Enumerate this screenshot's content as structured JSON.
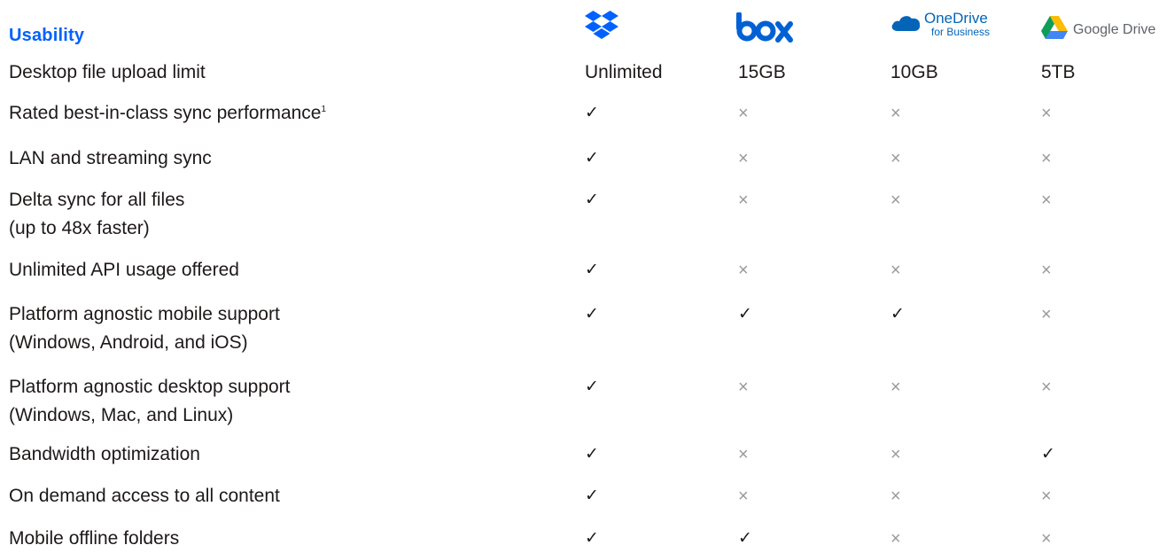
{
  "section_title": "Usability",
  "providers": [
    {
      "name": "Dropbox",
      "icon": "dropbox-logo-icon",
      "color": "#0061fe"
    },
    {
      "name": "box",
      "icon": "box-logo-icon",
      "color": "#0061d5"
    },
    {
      "name": "OneDrive",
      "subtitle": "for Business",
      "icon": "onedrive-cloud-icon",
      "color": "#0364b8"
    },
    {
      "name": "Google Drive",
      "icon": "google-drive-triangle-icon",
      "color": "#5f6368"
    }
  ],
  "rows": [
    {
      "label": [
        "Desktop file upload limit"
      ],
      "values": [
        "Unlimited",
        "15GB",
        "10GB",
        "5TB"
      ]
    },
    {
      "label": [
        "Rated best-in-class sync performance"
      ],
      "footnote": "1",
      "values": [
        "check",
        "cross",
        "cross",
        "cross"
      ]
    },
    {
      "label": [
        "LAN and streaming sync"
      ],
      "values": [
        "check",
        "cross",
        "cross",
        "cross"
      ]
    },
    {
      "label": [
        "Delta sync for all files",
        "(up to 48x faster)"
      ],
      "values": [
        "check",
        "cross",
        "cross",
        "cross"
      ]
    },
    {
      "label": [
        "Unlimited API usage offered"
      ],
      "values": [
        "check",
        "cross",
        "cross",
        "cross"
      ]
    },
    {
      "label": [
        "Platform agnostic mobile support",
        "(Windows, Android, and iOS)"
      ],
      "values": [
        "check",
        "check",
        "check",
        "cross"
      ]
    },
    {
      "label": [
        "Platform agnostic desktop support",
        "(Windows, Mac, and Linux)"
      ],
      "values": [
        "check",
        "cross",
        "cross",
        "cross"
      ]
    },
    {
      "label": [
        "Bandwidth optimization"
      ],
      "values": [
        "check",
        "cross",
        "cross",
        "check"
      ]
    },
    {
      "label": [
        "On demand access to all content"
      ],
      "values": [
        "check",
        "cross",
        "cross",
        "cross"
      ]
    },
    {
      "label": [
        "Mobile offline folders"
      ],
      "values": [
        "check",
        "check",
        "cross",
        "cross"
      ]
    }
  ],
  "glyphs": {
    "check": "✓",
    "cross": "×"
  }
}
